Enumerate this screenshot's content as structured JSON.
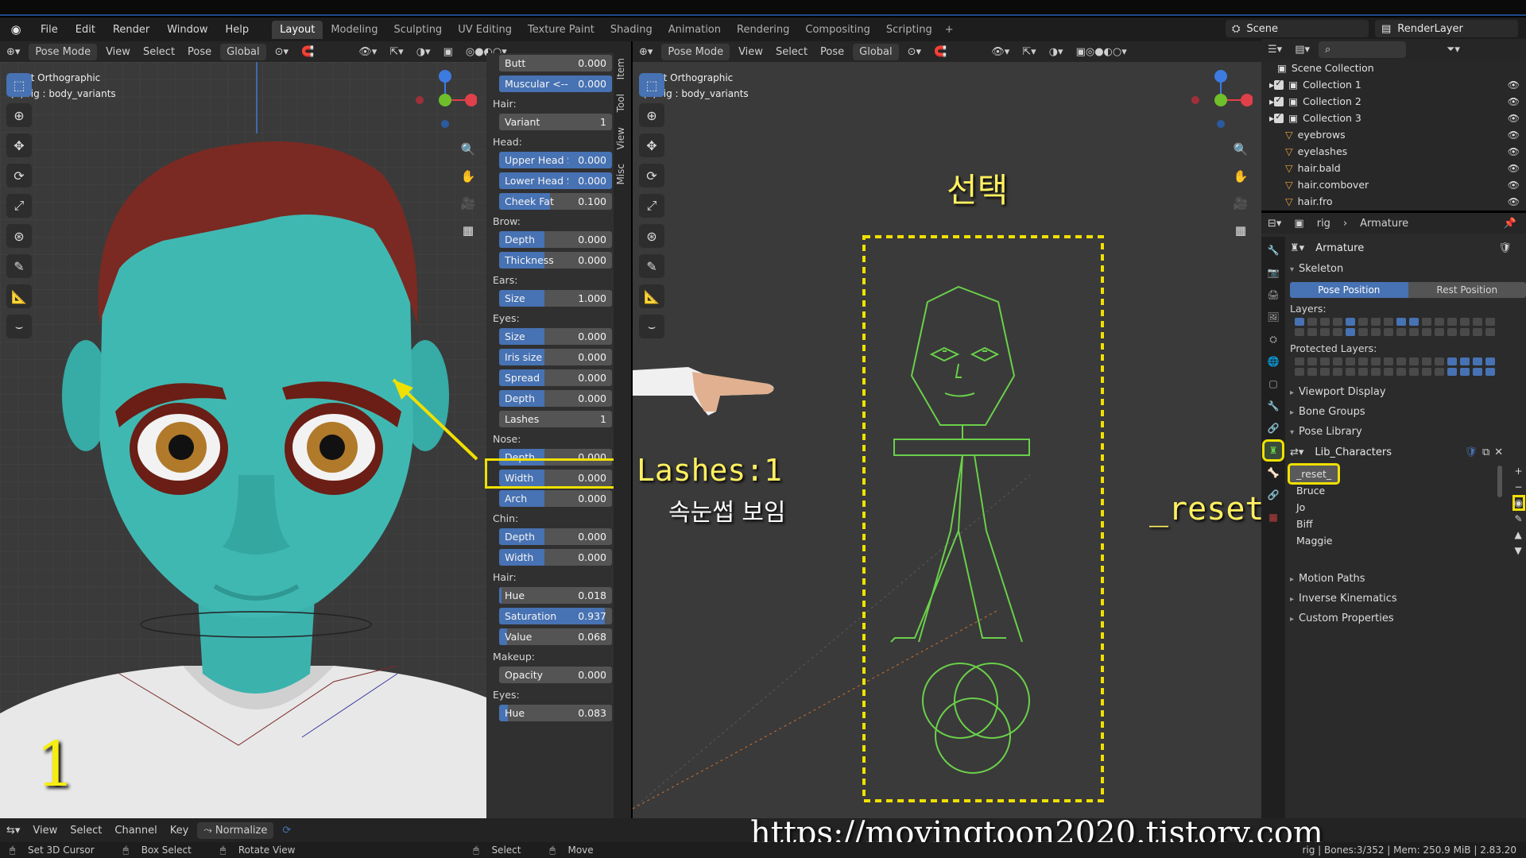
{
  "menu": [
    "File",
    "Edit",
    "Render",
    "Window",
    "Help"
  ],
  "workspaces": [
    "Layout",
    "Modeling",
    "Sculpting",
    "UV Editing",
    "Texture Paint",
    "Shading",
    "Animation",
    "Rendering",
    "Compositing",
    "Scripting"
  ],
  "scene": "Scene",
  "render_layer": "RenderLayer",
  "viewport_header": {
    "mode": "Pose Mode",
    "view": "View",
    "select": "Select",
    "pose": "Pose",
    "orient": "Global"
  },
  "viewport_info": {
    "view": "Front Orthographic",
    "object": "(4) rig : body_variants"
  },
  "npanel_tabs": [
    "Item",
    "Tool",
    "View",
    "Misc"
  ],
  "npanel": [
    {
      "type": "slider",
      "label": "Butt",
      "value": "0.000",
      "fill": 0
    },
    {
      "type": "slider",
      "label": "Muscular <--->",
      "value": "0.000",
      "fill": 1
    },
    {
      "type": "section",
      "label": "Hair:"
    },
    {
      "type": "slider",
      "label": "Variant",
      "value": "1",
      "fill": 0,
      "center": true
    },
    {
      "type": "section",
      "label": "Head:"
    },
    {
      "type": "slider",
      "label": "Upper Head Siz",
      "value": "0.000",
      "fill": 1
    },
    {
      "type": "slider",
      "label": "Lower Head Siz",
      "value": "0.000",
      "fill": 1
    },
    {
      "type": "slider",
      "label": "Cheek Fat",
      "value": "0.100",
      "fill": 0.45
    },
    {
      "type": "section",
      "label": "Brow:"
    },
    {
      "type": "slider",
      "label": "Depth",
      "value": "0.000",
      "fill": 0.4
    },
    {
      "type": "slider",
      "label": "Thickness",
      "value": "0.000",
      "fill": 0.4
    },
    {
      "type": "section",
      "label": "Ears:"
    },
    {
      "type": "slider",
      "label": "Size",
      "value": "1.000",
      "fill": 0.4
    },
    {
      "type": "section",
      "label": "Eyes:"
    },
    {
      "type": "slider",
      "label": "Size",
      "value": "0.000",
      "fill": 0.4
    },
    {
      "type": "slider",
      "label": "Iris size",
      "value": "0.000",
      "fill": 0.4
    },
    {
      "type": "slider",
      "label": "Spread",
      "value": "0.000",
      "fill": 0.4
    },
    {
      "type": "slider",
      "label": "Depth",
      "value": "0.000",
      "fill": 0.4
    },
    {
      "type": "slider",
      "label": "Lashes",
      "value": "1",
      "fill": 0,
      "center": true,
      "highlight": true
    },
    {
      "type": "section",
      "label": "Nose:"
    },
    {
      "type": "slider",
      "label": "Depth",
      "value": "0.000",
      "fill": 0.4
    },
    {
      "type": "slider",
      "label": "Width",
      "value": "0.000",
      "fill": 0.4
    },
    {
      "type": "slider",
      "label": "Arch",
      "value": "0.000",
      "fill": 0.4
    },
    {
      "type": "section",
      "label": "Chin:"
    },
    {
      "type": "slider",
      "label": "Depth",
      "value": "0.000",
      "fill": 0.4
    },
    {
      "type": "slider",
      "label": "Width",
      "value": "0.000",
      "fill": 0.4
    },
    {
      "type": "section",
      "label": "Hair:"
    },
    {
      "type": "slider",
      "label": "Hue",
      "value": "0.018",
      "fill": 0.02
    },
    {
      "type": "slider",
      "label": "Saturation",
      "value": "0.937",
      "fill": 0.94
    },
    {
      "type": "slider",
      "label": "Value",
      "value": "0.068",
      "fill": 0.07
    },
    {
      "type": "section",
      "label": "Makeup:"
    },
    {
      "type": "slider",
      "label": "Opacity",
      "value": "0.000",
      "fill": 0
    },
    {
      "type": "section",
      "label": "Eyes:"
    },
    {
      "type": "slider",
      "label": "Hue",
      "value": "0.083",
      "fill": 0.08
    }
  ],
  "outliner": {
    "root": "Scene Collection",
    "rows": [
      {
        "name": "Collection 1",
        "level": 1
      },
      {
        "name": "Collection 2",
        "level": 1
      },
      {
        "name": "Collection 3",
        "level": 1
      },
      {
        "name": "eyebrows",
        "level": 2
      },
      {
        "name": "eyelashes",
        "level": 2
      },
      {
        "name": "hair.bald",
        "level": 2
      },
      {
        "name": "hair.combover",
        "level": 2
      },
      {
        "name": "hair.fro",
        "level": 2
      }
    ]
  },
  "props": {
    "crumb_obj": "rig",
    "crumb_data": "Armature",
    "data_name": "Armature",
    "skeleton": "Skeleton",
    "pose_position": "Pose Position",
    "rest_position": "Rest Position",
    "layers": "Layers:",
    "protected_layers": "Protected Layers:",
    "viewport_display": "Viewport Display",
    "bone_groups": "Bone Groups",
    "pose_library": "Pose Library",
    "library_name": "Lib_Characters",
    "poses": [
      "_reset_",
      "Bruce",
      "Jo",
      "Biff",
      "Maggie"
    ],
    "motion_paths": "Motion Paths",
    "inverse_kinematics": "Inverse Kinematics",
    "custom_properties": "Custom Properties"
  },
  "timeline": {
    "view": "View",
    "select": "Select",
    "channel": "Channel",
    "key": "Key",
    "normalize": "Normalize"
  },
  "status": {
    "cursor": "Set 3D Cursor",
    "box": "Box Select",
    "rotate": "Rotate View",
    "select": "Select",
    "move": "Move",
    "stats": "rig | Bones:3/352 | Mem: 250.9 MiB | 2.83.20"
  },
  "annotations": {
    "select_ko": "선택",
    "lashes": "Lashes:1",
    "lashes_ko": "속눈썹 보임",
    "reset": "_reset_",
    "num": "1",
    "url": "https://movingtoon2020.tistory.com"
  },
  "colors": {
    "accent": "#4772b3",
    "highlight": "#f0e000",
    "skin": "#3fb6b0",
    "rig": "#6ad04a"
  }
}
